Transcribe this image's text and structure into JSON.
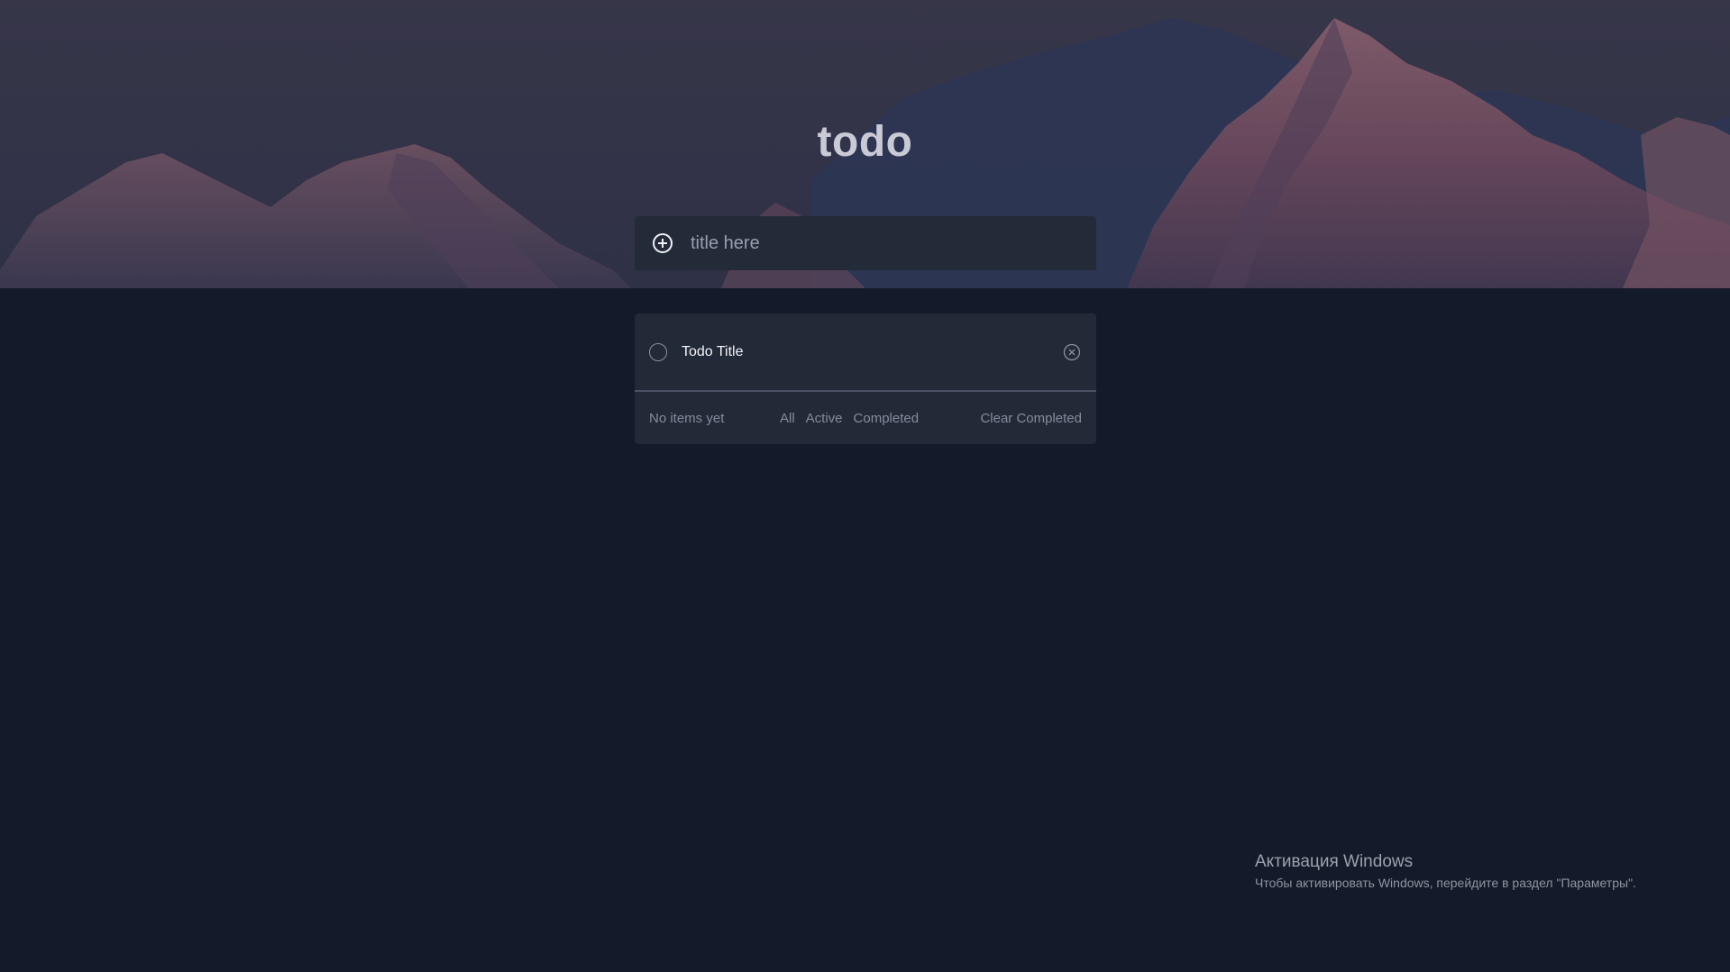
{
  "app": {
    "title": "todo"
  },
  "new_todo": {
    "placeholder": "title here",
    "value": "",
    "icon": "plus-circle-icon"
  },
  "todos": [
    {
      "title": "Todo Title",
      "completed": false
    }
  ],
  "footer": {
    "count_text": "No items yet",
    "filters": [
      "All",
      "Active",
      "Completed"
    ],
    "clear_label": "Clear Completed"
  },
  "os_overlay": {
    "title": "Активация Windows",
    "subtitle": "Чтобы активировать Windows, перейдите в раздел \"Параметры\"."
  },
  "colors": {
    "page_bg": "#131a29",
    "card_bg": "#222a38",
    "title_color": "#c9cad6"
  }
}
